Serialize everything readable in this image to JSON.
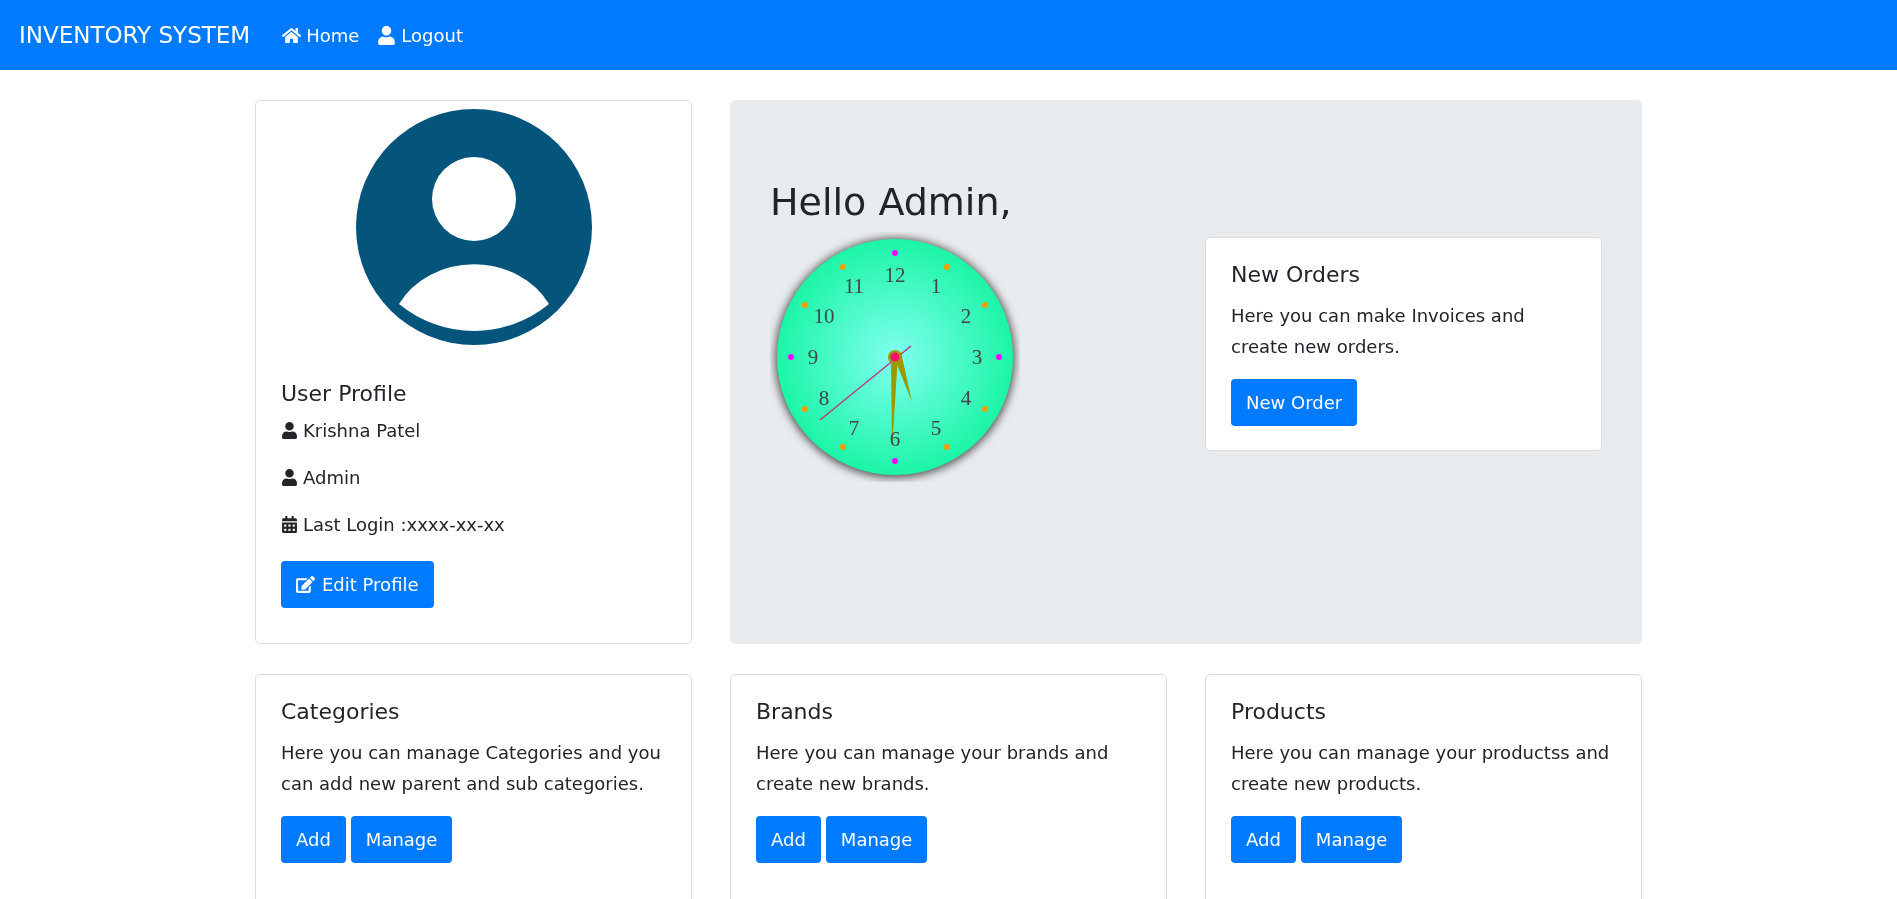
{
  "navbar": {
    "brand": "INVENTORY SYSTEM",
    "links": [
      {
        "kind": "home",
        "label": "Home"
      },
      {
        "kind": "user",
        "label": "Logout"
      }
    ]
  },
  "profile": {
    "title": "User Profile",
    "lines": [
      {
        "kind": "user",
        "text": "Krishna Patel"
      },
      {
        "kind": "user",
        "text": "Admin"
      },
      {
        "kind": "calendar",
        "text": "Last Login :xxxx-xx-xx"
      }
    ],
    "button": "Edit Profile"
  },
  "welcome": {
    "greeting": "Hello Admin,",
    "clock_numerals": [
      "12",
      "1",
      "2",
      "3",
      "4",
      "5",
      "6",
      "7",
      "8",
      "9",
      "10",
      "11"
    ],
    "card": {
      "title": "New Orders",
      "text": "Here you can make Invoices and create new orders.",
      "button": "New Order"
    }
  },
  "cards": [
    {
      "title": "Categories",
      "text": "Here you can manage Categories and you can add new parent and sub categories.",
      "buttons": [
        "Add",
        "Manage"
      ]
    },
    {
      "title": "Brands",
      "text": "Here you can manage your brands and create new brands.",
      "buttons": [
        "Add",
        "Manage"
      ]
    },
    {
      "title": "Products",
      "text": "Here you can manage your productss and create new products.",
      "buttons": [
        "Add",
        "Manage"
      ]
    }
  ]
}
